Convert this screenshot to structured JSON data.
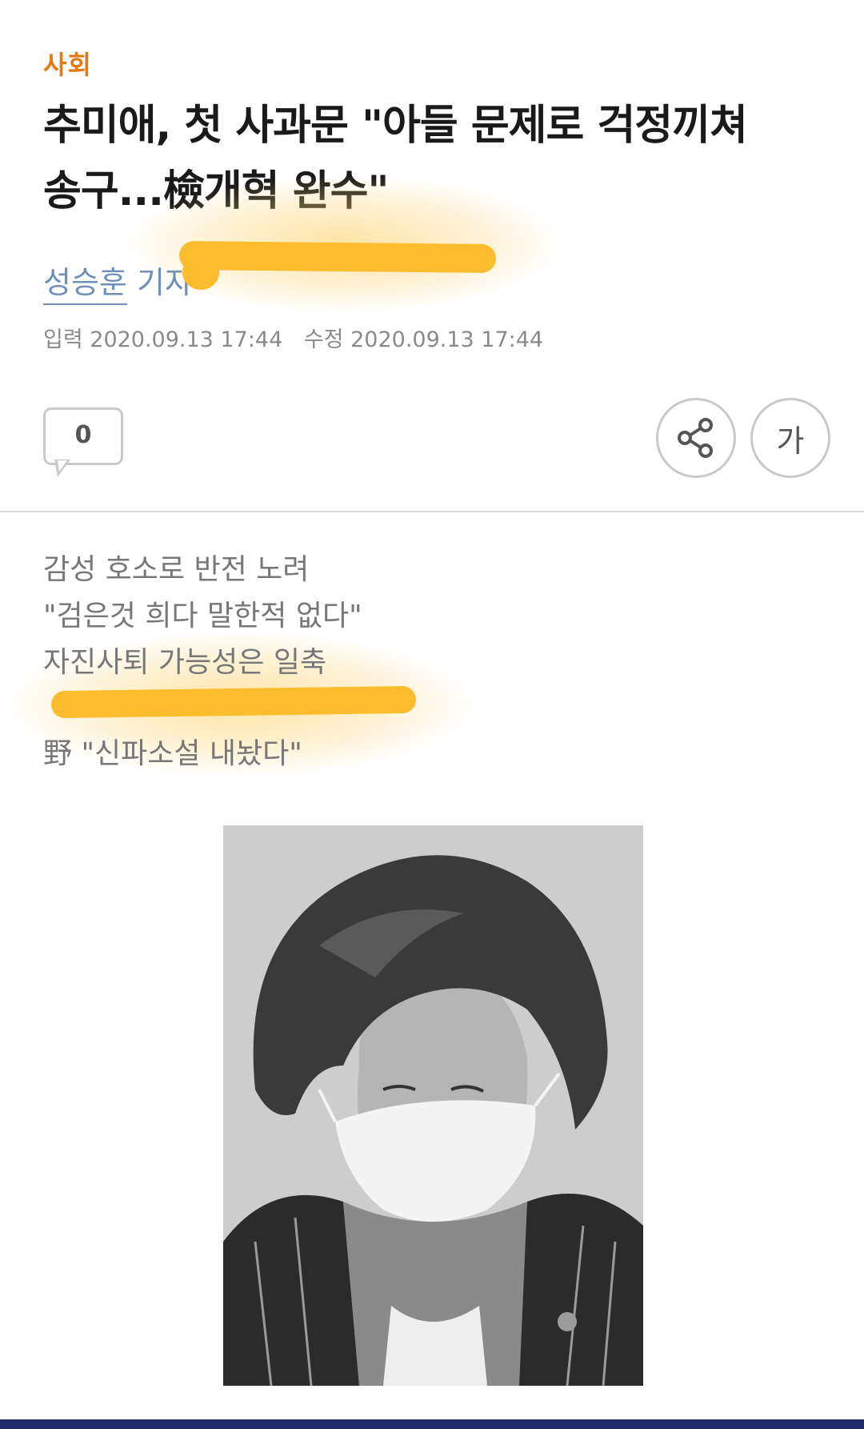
{
  "article": {
    "section": "사회",
    "headline_line1": "추미애, 첫 사과문 \"아들 문제로 걱정끼쳐",
    "headline_line2": "송구...檢개혁 완수\"",
    "reporter_name": "성승훈",
    "reporter_role": "기자",
    "published": "입력 2020.09.13 17:44",
    "modified": "수정 2020.09.13 17:44"
  },
  "actions": {
    "comment_count": "0",
    "font_size_label": "가"
  },
  "summary": [
    "감성 호소로 반전 노려",
    "\"검은것 희다 말한적 없다\"",
    "자진사퇴 가능성은 일축",
    "野 \"신파소설 내놨다\""
  ],
  "colors": {
    "section": "#e07b14",
    "byline": "#6f8fb8",
    "highlight": "#fbbd2e",
    "bottom_bar": "#1f2a6b"
  },
  "icons": [
    "share-icon",
    "comment-bubble-icon"
  ]
}
